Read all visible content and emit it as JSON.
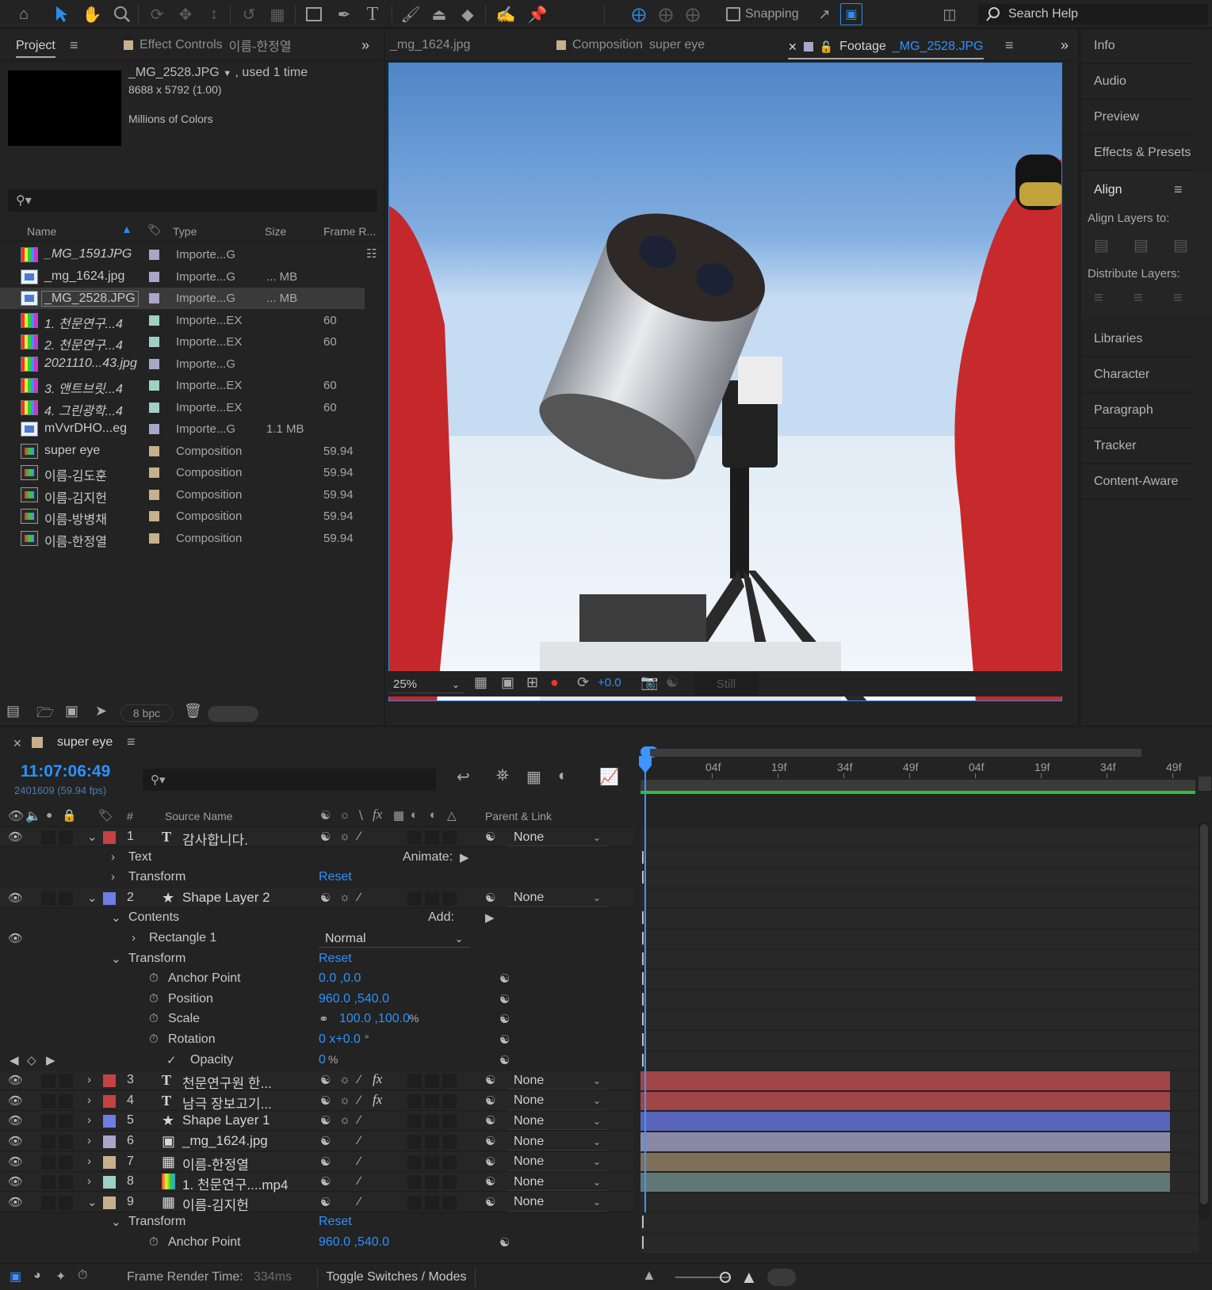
{
  "toolbar": {
    "snapping_label": "Snapping",
    "search_help": "Search Help"
  },
  "project_panel": {
    "tab_project": "Project",
    "tab_effect_controls": "Effect Controls",
    "effect_controls_target": "이름-한정열",
    "selected_name": "_MG_2528.JPG",
    "used_text": ", used 1 time",
    "dimensions": "8688 x 5792 (1.00)",
    "colors": "Millions of Colors",
    "columns": {
      "name": "Name",
      "type": "Type",
      "size": "Size",
      "frame_rate": "Frame R..."
    },
    "items": [
      {
        "name": "_MG_1591JPG",
        "icon": "image-sequence-icon",
        "italic": true,
        "label_color": "#a9a6c9",
        "type": "Importe...G",
        "size": "",
        "fps": ""
      },
      {
        "name": "_mg_1624.jpg",
        "icon": "image-icon",
        "italic": false,
        "label_color": "#a9a6c9",
        "type": "Importe...G",
        "size": "... MB",
        "fps": ""
      },
      {
        "name": "_MG_2528.JPG",
        "icon": "image-icon",
        "italic": false,
        "label_color": "#a9a6c9",
        "type": "Importe...G",
        "size": "... MB",
        "fps": "",
        "selected": true
      },
      {
        "name": "1. 천문연구...4",
        "icon": "video-icon",
        "italic": true,
        "label_color": "#9fd1c3",
        "type": "Importe...EX",
        "size": "",
        "fps": "60"
      },
      {
        "name": "2. 천문연구...4",
        "icon": "video-icon",
        "italic": true,
        "label_color": "#9fd1c3",
        "type": "Importe...EX",
        "size": "",
        "fps": "60"
      },
      {
        "name": "2021110...43.jpg",
        "icon": "image-sequence-icon",
        "italic": true,
        "label_color": "#a9a6c9",
        "type": "Importe...G",
        "size": "",
        "fps": ""
      },
      {
        "name": "3. 앤트브릿...4",
        "icon": "video-icon",
        "italic": true,
        "label_color": "#9fd1c3",
        "type": "Importe...EX",
        "size": "",
        "fps": "60"
      },
      {
        "name": "4. 그린광학...4",
        "icon": "video-icon",
        "italic": true,
        "label_color": "#9fd1c3",
        "type": "Importe...EX",
        "size": "",
        "fps": "60"
      },
      {
        "name": "mVvrDHO...eg",
        "icon": "image-icon",
        "italic": false,
        "label_color": "#a9a6c9",
        "type": "Importe...G",
        "size": "1.1 MB",
        "fps": ""
      },
      {
        "name": "super eye",
        "icon": "composition-icon",
        "italic": false,
        "label_color": "#c8b08d",
        "type": "Composition",
        "size": "",
        "fps": "59.94"
      },
      {
        "name": "이름-김도훈",
        "icon": "composition-icon",
        "italic": false,
        "label_color": "#c8b08d",
        "type": "Composition",
        "size": "",
        "fps": "59.94"
      },
      {
        "name": "이름-김지헌",
        "icon": "composition-icon",
        "italic": false,
        "label_color": "#c8b08d",
        "type": "Composition",
        "size": "",
        "fps": "59.94"
      },
      {
        "name": "이름-방병채",
        "icon": "composition-icon",
        "italic": false,
        "label_color": "#c8b08d",
        "type": "Composition",
        "size": "",
        "fps": "59.94"
      },
      {
        "name": "이름-한정열",
        "icon": "composition-icon",
        "italic": false,
        "label_color": "#c8b08d",
        "type": "Composition",
        "size": "",
        "fps": "59.94"
      }
    ],
    "bpc": "8 bpc"
  },
  "viewer": {
    "tab1": "_mg_1624.jpg",
    "tab2_prefix": "Composition",
    "tab2_name": "super eye",
    "tab3_prefix": "Footage",
    "tab3_name": "_MG_2528.JPG",
    "zoom": "25%",
    "exposure": "+0.0",
    "still": "Still"
  },
  "right_panel": {
    "items_top": [
      "Info",
      "Audio",
      "Preview",
      "Effects & Presets"
    ],
    "align_title": "Align",
    "align_layers_to": "Align Layers to:",
    "distribute_layers": "Distribute Layers:",
    "items_bottom": [
      "Libraries",
      "Character",
      "Paragraph",
      "Tracker",
      "Content-Aware"
    ]
  },
  "timeline": {
    "comp_name": "super eye",
    "timecode": "11:07:06:49",
    "frame_info": "2401609 (59.94 fps)",
    "col_num": "#",
    "col_source": "Source Name",
    "col_parent": "Parent & Link",
    "ruler": [
      "04f",
      "19f",
      "34f",
      "49f",
      "04f",
      "19f",
      "34f",
      "49f"
    ],
    "layers": [
      {
        "num": "1",
        "kind": "text",
        "name": "감사합니다.",
        "color": "#c44242",
        "parent": "None",
        "expanded": true
      },
      {
        "num": "2",
        "kind": "shape",
        "name": "Shape Layer 2",
        "color": "#6e7ee6",
        "parent": "None",
        "expanded": true
      },
      {
        "num": "3",
        "kind": "text",
        "name": "천문연구원 한...",
        "color": "#c44242",
        "parent": "None",
        "fx": true,
        "bar": "#a24549"
      },
      {
        "num": "4",
        "kind": "text",
        "name": "남극 장보고기...",
        "color": "#c44242",
        "parent": "None",
        "fx": true,
        "bar": "#a24549"
      },
      {
        "num": "5",
        "kind": "shape",
        "name": "Shape Layer 1",
        "color": "#6e7ee6",
        "parent": "None",
        "bar": "#5965b8"
      },
      {
        "num": "6",
        "kind": "image",
        "name": "_mg_1624.jpg",
        "color": "#a9a6c9",
        "parent": "None",
        "bar": "#8b88a6"
      },
      {
        "num": "7",
        "kind": "comp",
        "name": "이름-한정열",
        "color": "#c8b08d",
        "parent": "None",
        "bar": "#7e705b"
      },
      {
        "num": "8",
        "kind": "video",
        "name": "1. 천문연구....mp4",
        "color": "#9fd1c3",
        "parent": "None",
        "bar": "#5f7875"
      },
      {
        "num": "9",
        "kind": "comp",
        "name": "이름-김지헌",
        "color": "#c8b08d",
        "parent": "None",
        "expanded": true
      }
    ],
    "props": {
      "text": "Text",
      "animate": "Animate:",
      "transform": "Transform",
      "reset": "Reset",
      "contents": "Contents",
      "add": "Add:",
      "rectangle": "Rectangle 1",
      "blend_mode": "Normal",
      "anchor_point": "Anchor Point",
      "anchor_value": "0.0 ,0.0",
      "position": "Position",
      "position_value": "960.0 ,540.0",
      "scale": "Scale",
      "scale_value": "100.0 ,100.0",
      "scale_unit": "%",
      "rotation": "Rotation",
      "rotation_value": "0 x+0.0",
      "rotation_unit": "°",
      "opacity": "Opacity",
      "opacity_value": "0",
      "opacity_unit": "%",
      "anchor_value_9": "960.0 ,540.0"
    },
    "footer_render_label": "Frame Render Time:",
    "footer_render_value": "334ms",
    "footer_toggle": "Toggle Switches / Modes"
  }
}
